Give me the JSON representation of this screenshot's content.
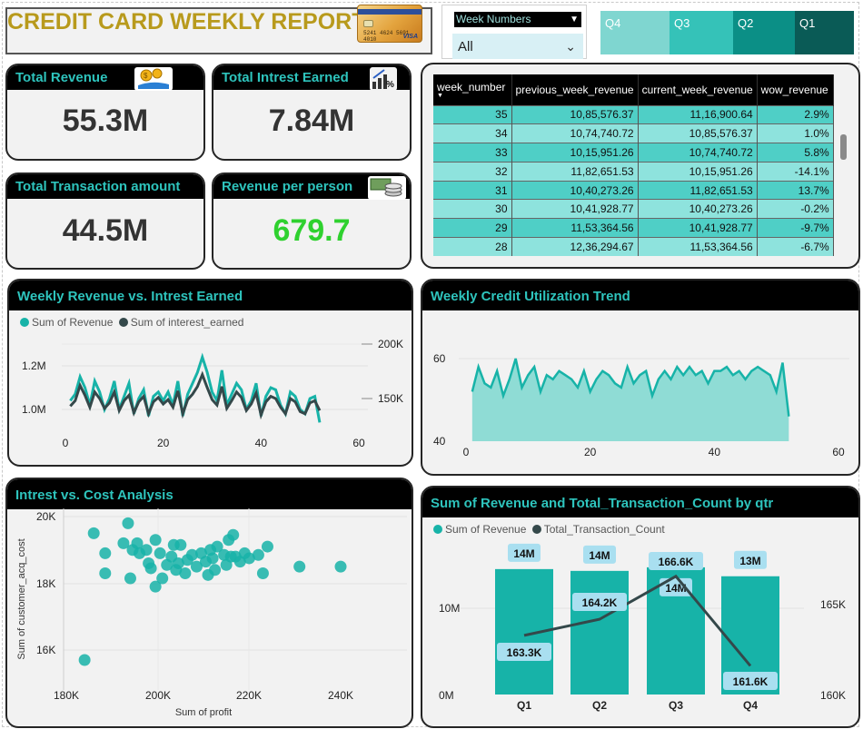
{
  "header": {
    "title": "CREDIT CARD WEEKLY REPORT",
    "card_image_number": "5241 4624 5691 4010",
    "card_image_brand": "VISA"
  },
  "week_slicer": {
    "label": "Week Numbers",
    "selected": "All"
  },
  "quarter_slicer": {
    "items": [
      {
        "label": "Q4",
        "color": "#7fd6d0"
      },
      {
        "label": "Q3",
        "color": "#35c2b8"
      },
      {
        "label": "Q2",
        "color": "#0b8f86"
      },
      {
        "label": "Q1",
        "color": "#0a5b56"
      }
    ]
  },
  "kpis": {
    "total_revenue": {
      "label": "Total Revenue",
      "value": "55.3M",
      "icon": "money-hand-icon"
    },
    "total_interest": {
      "label": "Total Intrest Earned",
      "value": "7.84M",
      "icon": "growth-percent-icon"
    },
    "total_transaction": {
      "label": "Total Transaction amount",
      "value": "44.5M"
    },
    "revenue_per_person": {
      "label": "Revenue per person",
      "value": "679.7",
      "icon": "coins-icon",
      "value_color": "#2fd12f"
    }
  },
  "week_table": {
    "columns": [
      "week_number",
      "previous_week_revenue",
      "current_week_revenue",
      "wow_revenue"
    ],
    "rows": [
      [
        "35",
        "10,85,576.37",
        "11,16,900.64",
        "2.9%"
      ],
      [
        "34",
        "10,74,740.72",
        "10,85,576.37",
        "1.0%"
      ],
      [
        "33",
        "10,15,951.26",
        "10,74,740.72",
        "5.8%"
      ],
      [
        "32",
        "11,82,651.53",
        "10,15,951.26",
        "-14.1%"
      ],
      [
        "31",
        "10,40,273.26",
        "11,82,651.53",
        "13.7%"
      ],
      [
        "30",
        "10,41,928.77",
        "10,40,273.26",
        "-0.2%"
      ],
      [
        "29",
        "11,53,364.56",
        "10,41,928.77",
        "-9.7%"
      ],
      [
        "28",
        "12,36,294.67",
        "11,53,364.56",
        "-6.7%"
      ]
    ],
    "row_colors": [
      "#4fcfc6",
      "#8ee3dd"
    ]
  },
  "chart_titles": {
    "weekly_revenue": "Weekly Revenue vs. Intrest Earned",
    "utilization": "Weekly Credit Utilization Trend",
    "scatter": "Intrest vs. Cost Analysis",
    "quarter": "Sum of Revenue and Total_Transaction_Count by qtr"
  },
  "chart_data": [
    {
      "type": "line",
      "title": "Weekly Revenue vs. Intrest Earned",
      "series": [
        {
          "name": "Sum of Revenue",
          "color": "#17b3a8",
          "axis": "left",
          "x": [
            1,
            2,
            3,
            4,
            5,
            6,
            7,
            8,
            9,
            10,
            11,
            12,
            13,
            14,
            15,
            16,
            17,
            18,
            19,
            20,
            21,
            22,
            23,
            24,
            25,
            26,
            27,
            28,
            29,
            30,
            31,
            32,
            33,
            34,
            35,
            36,
            37,
            38,
            39,
            40,
            41,
            42,
            43,
            44,
            45,
            46,
            47,
            48,
            49,
            50,
            51,
            52
          ],
          "values": [
            1.04,
            1.07,
            1.15,
            1.1,
            1.02,
            1.13,
            1.08,
            1.0,
            1.05,
            1.13,
            1.0,
            1.06,
            1.12,
            0.98,
            1.05,
            1.09,
            0.97,
            1.06,
            1.08,
            1.04,
            1.08,
            1.02,
            1.13,
            0.97,
            1.07,
            1.12,
            1.17,
            1.24,
            1.17,
            1.08,
            1.04,
            1.18,
            1.02,
            1.07,
            1.12,
            1.09,
            1.0,
            1.04,
            1.12,
            0.97,
            1.06,
            1.1,
            1.09,
            1.02,
            0.98,
            1.08,
            1.06,
            1.0,
            0.98,
            1.05,
            1.06,
            0.94
          ]
        },
        {
          "name": "Sum of interest_earned",
          "color": "#34484a",
          "axis": "right",
          "x": [
            1,
            2,
            3,
            4,
            5,
            6,
            7,
            8,
            9,
            10,
            11,
            12,
            13,
            14,
            15,
            16,
            17,
            18,
            19,
            20,
            21,
            22,
            23,
            24,
            25,
            26,
            27,
            28,
            29,
            30,
            31,
            32,
            33,
            34,
            35,
            36,
            37,
            38,
            39,
            40,
            41,
            42,
            43,
            44,
            45,
            46,
            47,
            48,
            49,
            50,
            51,
            52
          ],
          "values": [
            143,
            148,
            162,
            153,
            142,
            156,
            150,
            141,
            146,
            156,
            139,
            148,
            153,
            137,
            147,
            152,
            136,
            147,
            151,
            145,
            149,
            142,
            157,
            136,
            149,
            154,
            161,
            172,
            160,
            149,
            144,
            161,
            141,
            148,
            156,
            151,
            139,
            145,
            155,
            135,
            147,
            152,
            150,
            142,
            136,
            150,
            147,
            138,
            136,
            146,
            148,
            139
          ]
        }
      ],
      "xlim": [
        0,
        60
      ],
      "x_ticks": [
        "0",
        "20",
        "40",
        "60"
      ],
      "y_left_ticks": [
        "1.0M",
        "1.2M"
      ],
      "y_right_ticks": [
        "150K",
        "200K"
      ],
      "legend": "top-left"
    },
    {
      "type": "area",
      "title": "Weekly Credit Utilization Trend",
      "x": [
        1,
        2,
        3,
        4,
        5,
        6,
        7,
        8,
        9,
        10,
        11,
        12,
        13,
        14,
        15,
        16,
        17,
        18,
        19,
        20,
        21,
        22,
        23,
        24,
        25,
        26,
        27,
        28,
        29,
        30,
        31,
        32,
        33,
        34,
        35,
        36,
        37,
        38,
        39,
        40,
        41,
        42,
        43,
        44,
        45,
        46,
        47,
        48,
        49,
        50,
        51,
        52
      ],
      "values": [
        52,
        58,
        54,
        53,
        57,
        51,
        55,
        60,
        53,
        56,
        58,
        52,
        56,
        55,
        57,
        56,
        55,
        53,
        57,
        52,
        55,
        57,
        56,
        54,
        53,
        58,
        54,
        56,
        57,
        51,
        55,
        57,
        55,
        58,
        56,
        58,
        56,
        57,
        54,
        57,
        57,
        58,
        56,
        57,
        55,
        57,
        58,
        57,
        56,
        52,
        59,
        46
      ],
      "xlim": [
        0,
        60
      ],
      "x_ticks": [
        "0",
        "20",
        "40",
        "60"
      ],
      "y_ticks": [
        "40",
        "60"
      ],
      "color": "#17b3a8"
    },
    {
      "type": "scatter",
      "title": "Intrest vs. Cost Analysis",
      "xlabel": "Sum of profit",
      "ylabel": "Sum of customer_acq_cost",
      "x_ticks": [
        "180K",
        "200K",
        "220K",
        "240K"
      ],
      "y_ticks": [
        "16K",
        "18K",
        "20K"
      ],
      "xlim": [
        180,
        240
      ],
      "ylim": [
        15.5,
        20
      ],
      "color": "#17b3a8",
      "points": [
        [
          184.0,
          15.7
        ],
        [
          186.0,
          19.5
        ],
        [
          188.5,
          18.9
        ],
        [
          188.5,
          18.3
        ],
        [
          192.5,
          19.2
        ],
        [
          193.5,
          19.8
        ],
        [
          194.5,
          19.0
        ],
        [
          194.0,
          18.15
        ],
        [
          195.5,
          19.2
        ],
        [
          196.0,
          18.9
        ],
        [
          197.5,
          19.0
        ],
        [
          198.0,
          18.6
        ],
        [
          198.5,
          18.45
        ],
        [
          199.5,
          17.9
        ],
        [
          199.5,
          19.3
        ],
        [
          200.5,
          18.9
        ],
        [
          201.0,
          18.15
        ],
        [
          202.0,
          18.55
        ],
        [
          203.0,
          18.8
        ],
        [
          203.5,
          19.15
        ],
        [
          204.0,
          18.4
        ],
        [
          204.5,
          18.6
        ],
        [
          205.0,
          19.15
        ],
        [
          206.0,
          18.3
        ],
        [
          206.5,
          18.7
        ],
        [
          207.5,
          18.85
        ],
        [
          208.5,
          18.5
        ],
        [
          209.5,
          18.9
        ],
        [
          210.5,
          18.65
        ],
        [
          211.0,
          18.25
        ],
        [
          211.5,
          19.0
        ],
        [
          212.0,
          18.75
        ],
        [
          212.5,
          18.4
        ],
        [
          213.0,
          19.1
        ],
        [
          214.5,
          18.85
        ],
        [
          215.0,
          18.55
        ],
        [
          215.5,
          19.3
        ],
        [
          216.0,
          18.8
        ],
        [
          216.5,
          19.45
        ],
        [
          217.0,
          18.8
        ],
        [
          218.0,
          18.65
        ],
        [
          219.0,
          18.9
        ],
        [
          220.0,
          18.75
        ],
        [
          222.0,
          18.85
        ],
        [
          223.0,
          18.3
        ],
        [
          224.0,
          19.1
        ],
        [
          231.0,
          18.5
        ],
        [
          240.0,
          18.5
        ]
      ]
    },
    {
      "type": "bar",
      "title": "Sum of Revenue and Total_Transaction_Count by qtr",
      "categories": [
        "Q1",
        "Q2",
        "Q3",
        "Q4"
      ],
      "series": [
        {
          "name": "Sum of Revenue",
          "type": "bar",
          "color": "#17b3a8",
          "axis": "left",
          "values": [
            14.0,
            13.8,
            14.2,
            13.2
          ],
          "labels": [
            "14M",
            "14M",
            "14M",
            "13M"
          ]
        },
        {
          "name": "Total_Transaction_Count",
          "type": "line",
          "color": "#34484a",
          "axis": "right",
          "values": [
            163.3,
            164.2,
            166.6,
            161.6
          ],
          "labels": [
            "163.3K",
            "164.2K",
            "166.6K",
            "161.6K"
          ]
        }
      ],
      "y_left_ticks": [
        "0M",
        "10M"
      ],
      "y_right_ticks": [
        "160K",
        "165K"
      ],
      "ylim_left": [
        0,
        15
      ],
      "ylim_right": [
        160,
        167.5
      ],
      "legend": "top-left"
    }
  ]
}
